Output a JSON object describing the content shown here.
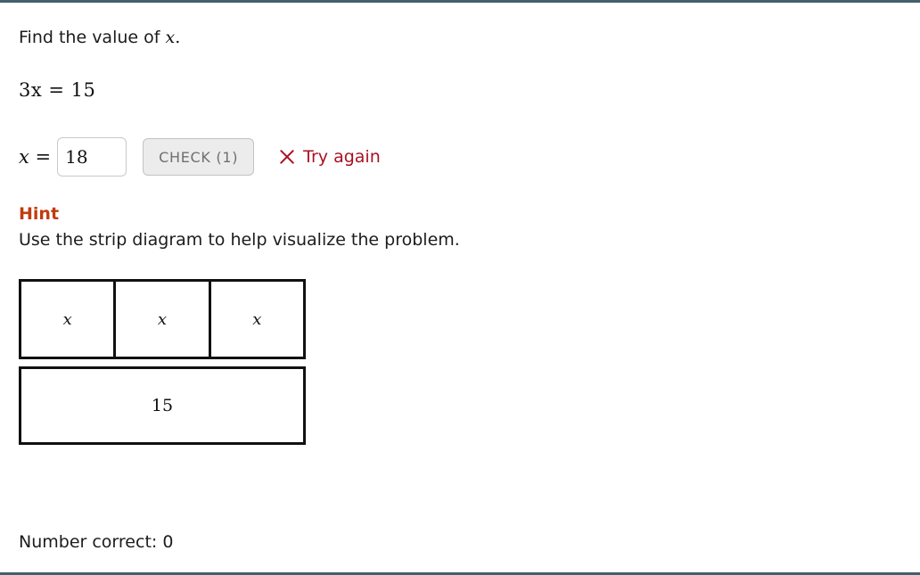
{
  "theme": {
    "rule_color": "#42606e",
    "hint_color": "#c23b0e",
    "feedback_color": "#aa1122",
    "strip_border_color": "#111111",
    "button_bg": "#ececec",
    "button_text": "#6f6f6f",
    "text_color": "#1c1c1c"
  },
  "problem": {
    "prompt_text": "Find the value of ",
    "prompt_variable": "x",
    "prompt_period": ".",
    "equation": "3x = 15"
  },
  "answer": {
    "label": "x =",
    "value": "18",
    "placeholder": "",
    "check_label": "CHECK (1)",
    "feedback_icon": "x-mark-icon",
    "feedback_text": "Try again"
  },
  "hint": {
    "title": "Hint",
    "body": "Use the strip diagram to help visualize the problem."
  },
  "strip_diagram": {
    "top_cells": [
      "x",
      "x",
      "x"
    ],
    "bottom_label": "15"
  },
  "footer": {
    "score_text": "Number correct: 0"
  }
}
